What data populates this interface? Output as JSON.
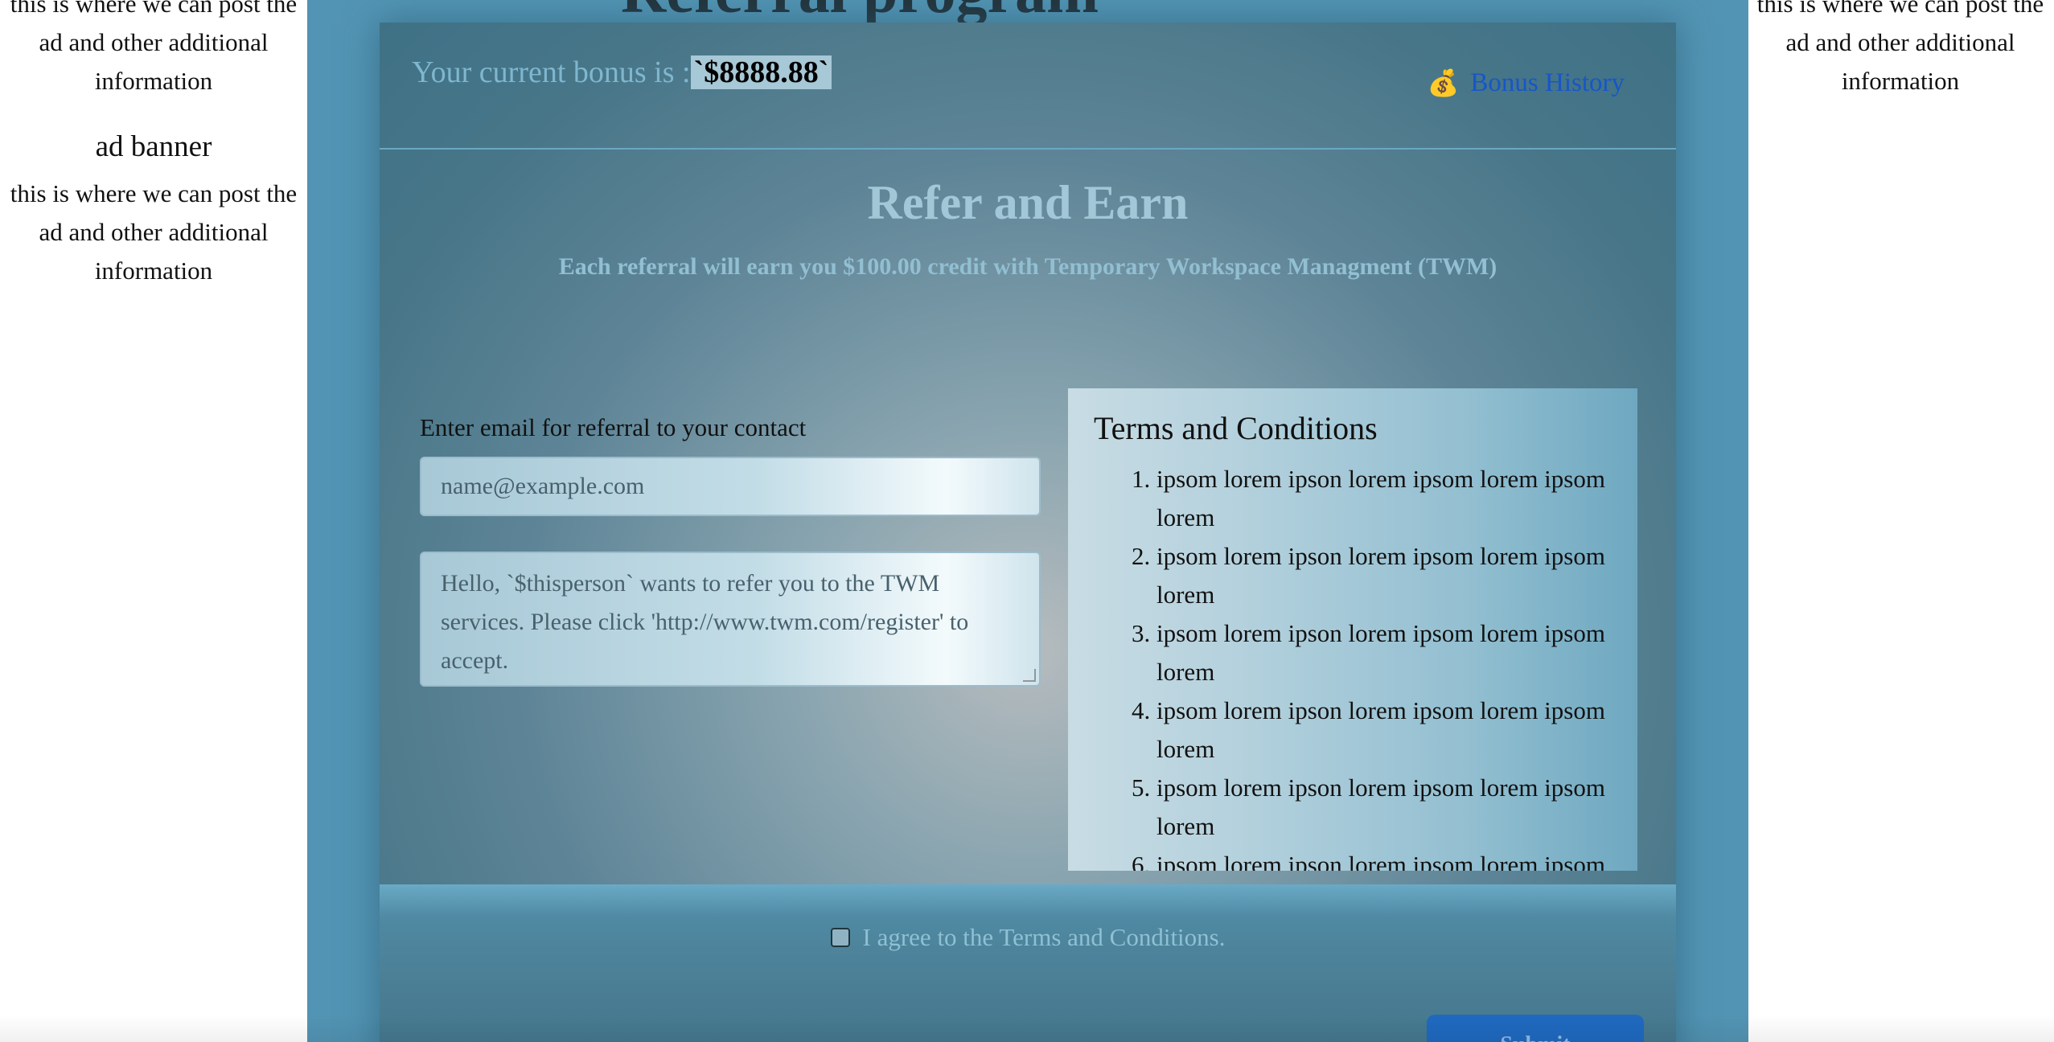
{
  "ads": {
    "left": {
      "text_top": "this is where we can post the ad and other additional information",
      "title": "ad banner",
      "text_bottom": "this is where we can post the ad and other additional information"
    },
    "right": {
      "text_top": "this is where we can post the ad and other additional information"
    }
  },
  "page": {
    "heading_peek": "Referral program"
  },
  "bonus": {
    "label": "Your current bonus is :",
    "amount": "`$8888.88`",
    "history_icon": "money-bag-icon",
    "history_label": "Bonus History"
  },
  "hero": {
    "title": "Refer and Earn",
    "subtitle": "Each referral will earn you $100.00 credit with Temporary Workspace Managment (TWM)"
  },
  "form": {
    "email_label": "Enter email for referral to your contact",
    "email_placeholder": "name@example.com",
    "message": "Hello, `$thisperson` wants to refer you to the TWM services. Please click 'http://www.twm.com/register' to accept."
  },
  "terms": {
    "title": "Terms and Conditions",
    "items": [
      "ipsom lorem ipson lorem ipsom lorem ipsom lorem",
      "ipsom lorem ipson lorem ipsom lorem ipsom lorem",
      "ipsom lorem ipson lorem ipsom lorem ipsom lorem",
      "ipsom lorem ipson lorem ipsom lorem ipsom lorem",
      "ipsom lorem ipson lorem ipsom lorem ipsom lorem",
      "ipsom lorem ipson lorem ipsom lorem ipsom lorem"
    ]
  },
  "agree": {
    "label": "I agree to the Terms and Conditions.",
    "checked": false
  },
  "submit": {
    "label": "Submit"
  },
  "colors": {
    "page_bg": "#5294b3",
    "link": "#1656c9",
    "button": "#1f69bf"
  }
}
